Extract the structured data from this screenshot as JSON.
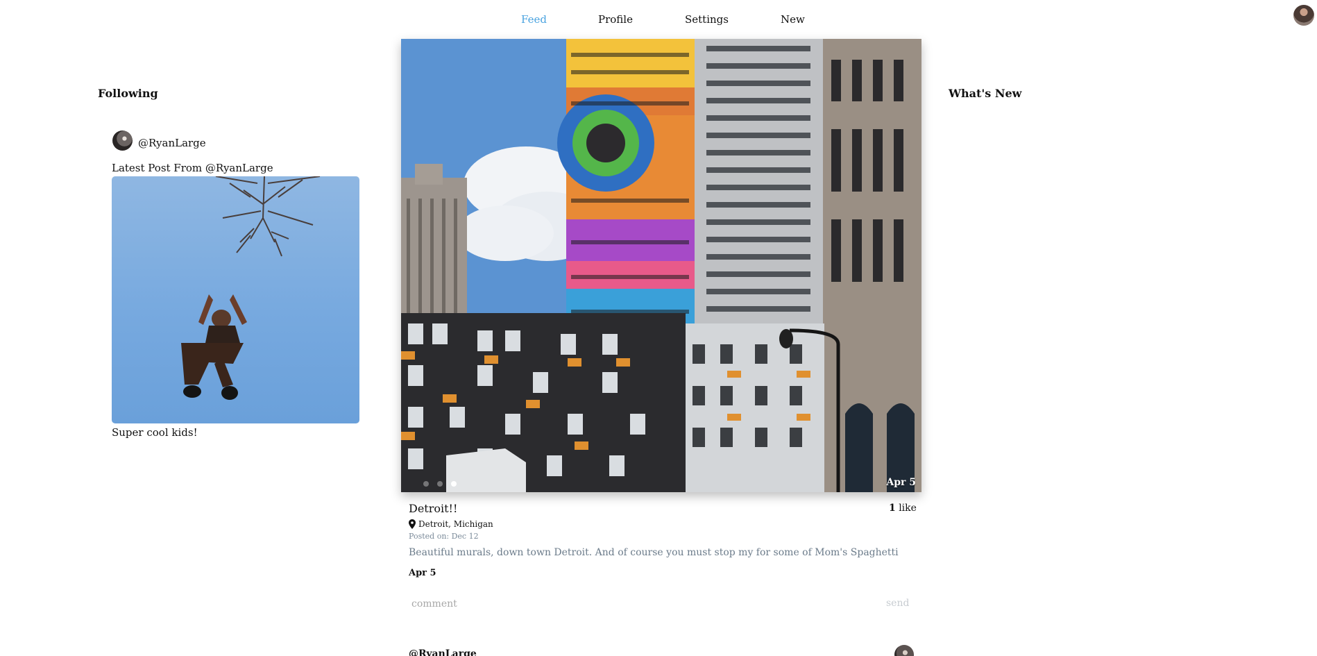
{
  "nav": {
    "items": [
      {
        "label": "Feed",
        "active": true
      },
      {
        "label": "Profile",
        "active": false
      },
      {
        "label": "Settings",
        "active": false
      },
      {
        "label": "New",
        "active": false
      }
    ],
    "accent_color": "#4aa3e0"
  },
  "following": {
    "title": "Following",
    "user": {
      "handle": "@RyanLarge"
    },
    "latest_label": "Latest Post From @RyanLarge",
    "latest_caption": "Super cool kids!"
  },
  "whats_new": {
    "title": "What's New"
  },
  "post": {
    "image_date": "Apr 5",
    "carousel": {
      "count": 3,
      "active_index": 2
    },
    "title": "Detroit!!",
    "likes_count": "1",
    "likes_label": "like",
    "location": "Detroit, Michigan",
    "posted_on": "Posted on: Dec 12",
    "description": "Beautiful murals, down town Detroit. And of course you must stop my for some of Mom's Spaghetti",
    "date": "Apr 5",
    "comment_placeholder": "comment",
    "send_label": "send"
  },
  "next_post": {
    "handle": "@RyanLarge"
  }
}
